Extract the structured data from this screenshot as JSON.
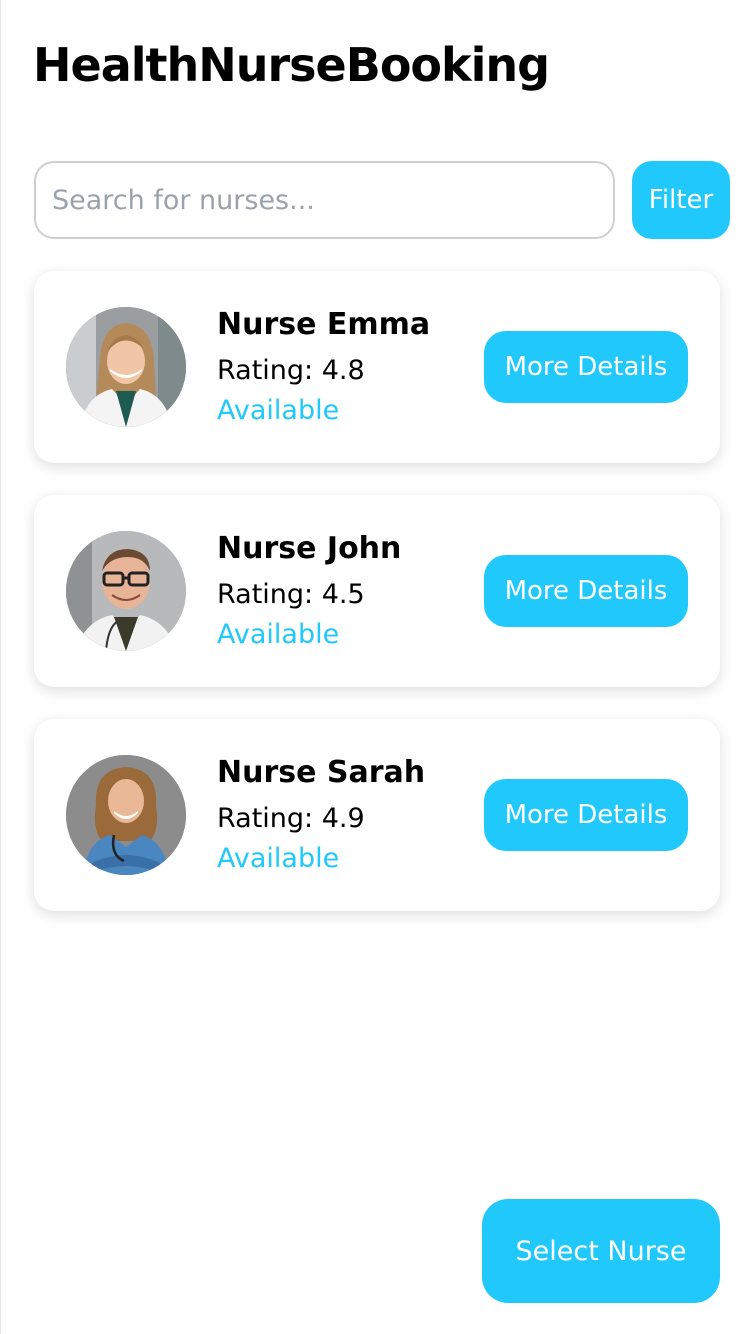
{
  "app": {
    "title": "HealthNurseBooking"
  },
  "search": {
    "placeholder": "Search for nurses...",
    "value": "",
    "filter_label": "Filter"
  },
  "nurses": [
    {
      "name": "Nurse Emma",
      "rating": "Rating: 4.8",
      "status": "Available",
      "details_label": "More Details",
      "photo": "nurse-emma-photo"
    },
    {
      "name": "Nurse John",
      "rating": "Rating: 4.5",
      "status": "Available",
      "details_label": "More Details",
      "photo": "nurse-john-photo"
    },
    {
      "name": "Nurse Sarah",
      "rating": "Rating: 4.9",
      "status": "Available",
      "details_label": "More Details",
      "photo": "nurse-sarah-photo"
    }
  ],
  "footer": {
    "select_label": "Select Nurse"
  },
  "colors": {
    "accent": "#21c8fb",
    "text": "#000000",
    "placeholder": "#9aa3ad",
    "background": "#ffffff"
  }
}
